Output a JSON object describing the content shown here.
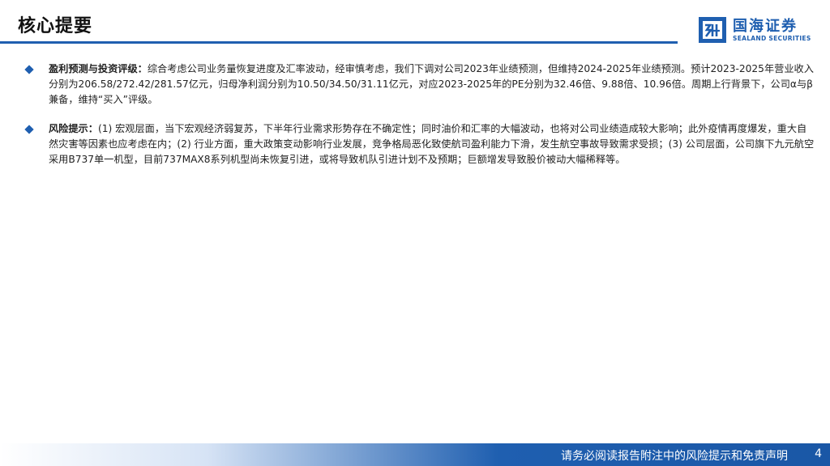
{
  "header": {
    "title": "核心提要",
    "logo_cn": "国海证券",
    "logo_en": "SEALAND SECURITIES"
  },
  "bullets": [
    {
      "label": "盈利预测与投资评级：",
      "text": "综合考虑公司业务量恢复进度及汇率波动，经审慎考虑，我们下调对公司2023年业绩预测，但维持2024-2025年业绩预测。预计2023-2025年营业收入分别为206.58/272.42/281.57亿元，归母净利润分别为10.50/34.50/31.11亿元，对应2023-2025年的PE分别为32.46倍、9.88倍、10.96倍。周期上行背景下，公司α与β兼备，维持“买入”评级。"
    },
    {
      "label": "风险提示：",
      "text": "(1) 宏观层面，当下宏观经济弱复苏，下半年行业需求形势存在不确定性；同时油价和汇率的大幅波动，也将对公司业绩造成较大影响；此外疫情再度爆发，重大自然灾害等因素也应考虑在内；(2) 行业方面，重大政策变动影响行业发展，竞争格局恶化致使航司盈利能力下滑，发生航空事故导致需求受损；(3) 公司层面，公司旗下九元航空采用B737单一机型，目前737MAX8系列机型尚未恢复引进，或将导致机队引进计划不及预期；巨额增发导致股价被动大幅稀释等。"
    }
  ],
  "footer": {
    "disclaimer": "请务必阅读报告附注中的风险提示和免责声明",
    "page_number": "4"
  },
  "colors": {
    "brand_blue": "#1f5fb0"
  }
}
